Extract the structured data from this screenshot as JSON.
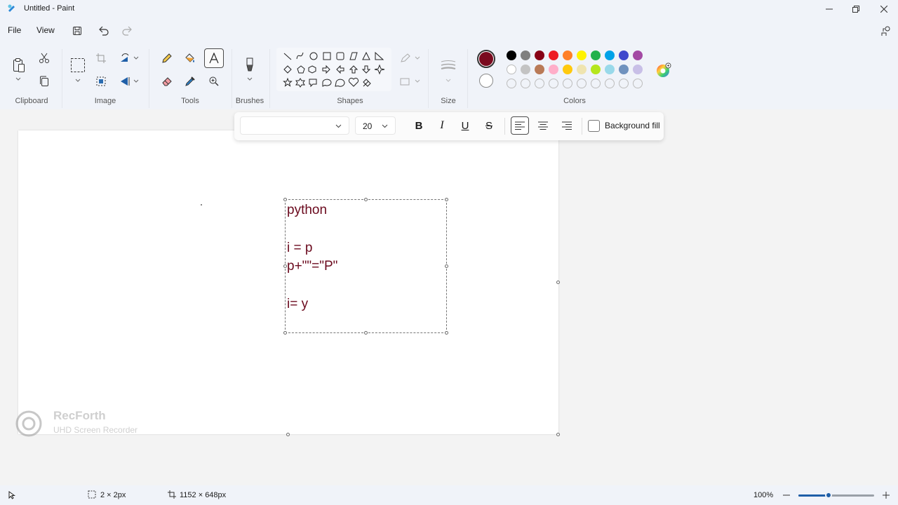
{
  "window": {
    "title": "Untitled - Paint"
  },
  "menu": {
    "file": "File",
    "view": "View"
  },
  "ribbon": {
    "clipboard_label": "Clipboard",
    "image_label": "Image",
    "tools_label": "Tools",
    "brushes_label": "Brushes",
    "shapes_label": "Shapes",
    "size_label": "Size",
    "colors_label": "Colors"
  },
  "colors": {
    "primary": "#7a0a1f",
    "secondary": "#ffffff",
    "palette_row1": [
      "#000000",
      "#7f7f7f",
      "#880015",
      "#ed1c24",
      "#ff7f27",
      "#fff200",
      "#22b14c",
      "#00a2e8",
      "#3f48cc",
      "#a349a4"
    ],
    "palette_row2": [
      "#ffffff",
      "#c3c3c3",
      "#b97a57",
      "#ffaec9",
      "#ffc90e",
      "#efe4b0",
      "#b5e61d",
      "#99d9ea",
      "#7092be",
      "#c8bfe7"
    ]
  },
  "textbar": {
    "font_value": "",
    "size_value": "20",
    "bold": "B",
    "italic": "I",
    "underline": "U",
    "strike": "S",
    "background_fill": "Background fill"
  },
  "canvas_text": {
    "line1": "python",
    "line2": "i = p",
    "line3": "p+\"\"=\"P\"",
    "line4": "i= y"
  },
  "status": {
    "selection_size": "2 × 2px",
    "canvas_size": "1152 × 648px",
    "zoom": "100%",
    "zoom_level": 0.5
  },
  "watermark": {
    "line1": "RecForth",
    "line2": "UHD Screen Recorder"
  }
}
